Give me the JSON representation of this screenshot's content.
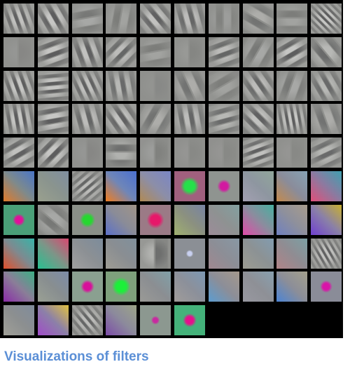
{
  "caption": "Visualizations of filters",
  "grid": {
    "rows": 10,
    "cols": 10,
    "empty_after": 96,
    "filters": [
      {
        "kind": "stripes",
        "angle": -20,
        "freq": 4,
        "contrast": 0.5
      },
      {
        "kind": "stripes",
        "angle": -30,
        "freq": 3,
        "contrast": 0.55
      },
      {
        "kind": "stripes",
        "angle": 80,
        "freq": 2,
        "contrast": 0.25
      },
      {
        "kind": "stripes",
        "angle": 10,
        "freq": 2,
        "contrast": 0.2
      },
      {
        "kind": "stripes",
        "angle": -40,
        "freq": 3,
        "contrast": 0.5
      },
      {
        "kind": "stripes",
        "angle": -15,
        "freq": 3,
        "contrast": 0.45
      },
      {
        "kind": "stripes",
        "angle": 0,
        "freq": 2,
        "contrast": 0.15
      },
      {
        "kind": "stripes",
        "angle": -60,
        "freq": 2,
        "contrast": 0.3
      },
      {
        "kind": "stripes",
        "angle": 90,
        "freq": 2,
        "contrast": 0.2
      },
      {
        "kind": "stripes",
        "angle": -45,
        "freq": 6,
        "contrast": 0.55
      },
      {
        "kind": "stripes",
        "angle": 0,
        "freq": 1,
        "contrast": 0.08
      },
      {
        "kind": "stripes",
        "angle": 70,
        "freq": 3,
        "contrast": 0.55
      },
      {
        "kind": "stripes",
        "angle": -20,
        "freq": 3,
        "contrast": 0.5
      },
      {
        "kind": "stripes",
        "angle": 45,
        "freq": 3,
        "contrast": 0.45
      },
      {
        "kind": "stripes",
        "angle": 80,
        "freq": 2,
        "contrast": 0.2
      },
      {
        "kind": "stripes",
        "angle": 0,
        "freq": 1,
        "contrast": 0.1
      },
      {
        "kind": "stripes",
        "angle": 70,
        "freq": 3,
        "contrast": 0.45
      },
      {
        "kind": "stripes",
        "angle": 30,
        "freq": 2,
        "contrast": 0.25
      },
      {
        "kind": "stripes",
        "angle": 60,
        "freq": 3,
        "contrast": 0.55
      },
      {
        "kind": "stripes",
        "angle": -40,
        "freq": 2,
        "contrast": 0.4
      },
      {
        "kind": "stripes",
        "angle": -20,
        "freq": 4,
        "contrast": 0.55
      },
      {
        "kind": "stripes",
        "angle": 85,
        "freq": 4,
        "contrast": 0.55
      },
      {
        "kind": "stripes",
        "angle": -25,
        "freq": 4,
        "contrast": 0.5
      },
      {
        "kind": "stripes",
        "angle": -10,
        "freq": 3,
        "contrast": 0.4
      },
      {
        "kind": "stripes",
        "angle": 0,
        "freq": 1,
        "contrast": 0.06
      },
      {
        "kind": "stripes",
        "angle": -25,
        "freq": 2,
        "contrast": 0.3
      },
      {
        "kind": "stripes",
        "angle": 60,
        "freq": 2,
        "contrast": 0.2
      },
      {
        "kind": "stripes",
        "angle": -35,
        "freq": 3,
        "contrast": 0.45
      },
      {
        "kind": "stripes",
        "angle": 20,
        "freq": 2,
        "contrast": 0.25
      },
      {
        "kind": "stripes",
        "angle": -30,
        "freq": 3,
        "contrast": 0.4
      },
      {
        "kind": "stripes",
        "angle": -10,
        "freq": 4,
        "contrast": 0.55
      },
      {
        "kind": "stripes",
        "angle": 80,
        "freq": 3,
        "contrast": 0.55
      },
      {
        "kind": "stripes",
        "angle": -15,
        "freq": 3,
        "contrast": 0.45
      },
      {
        "kind": "stripes",
        "angle": -35,
        "freq": 3,
        "contrast": 0.5
      },
      {
        "kind": "stripes",
        "angle": 30,
        "freq": 2,
        "contrast": 0.3
      },
      {
        "kind": "stripes",
        "angle": -10,
        "freq": 3,
        "contrast": 0.45
      },
      {
        "kind": "stripes",
        "angle": 75,
        "freq": 3,
        "contrast": 0.4
      },
      {
        "kind": "stripes",
        "angle": -45,
        "freq": 3,
        "contrast": 0.5
      },
      {
        "kind": "stripes",
        "angle": -10,
        "freq": 5,
        "contrast": 0.55
      },
      {
        "kind": "stripes",
        "angle": -20,
        "freq": 2,
        "contrast": 0.3
      },
      {
        "kind": "stripes",
        "angle": 60,
        "freq": 3,
        "contrast": 0.5
      },
      {
        "kind": "stripes",
        "angle": 45,
        "freq": 3,
        "contrast": 0.55
      },
      {
        "kind": "stripes",
        "angle": 0,
        "freq": 1,
        "contrast": 0.08
      },
      {
        "kind": "stripes",
        "angle": 90,
        "freq": 2,
        "contrast": 0.35
      },
      {
        "kind": "stripes",
        "angle": 0,
        "freq": 1,
        "contrast": 0.15
      },
      {
        "kind": "stripes",
        "angle": 0,
        "freq": 1,
        "contrast": 0.07
      },
      {
        "kind": "stripes",
        "angle": 0,
        "freq": 1,
        "contrast": 0.07
      },
      {
        "kind": "stripes",
        "angle": 70,
        "freq": 4,
        "contrast": 0.5
      },
      {
        "kind": "stripes",
        "angle": 0,
        "freq": 1,
        "contrast": 0.07
      },
      {
        "kind": "stripes",
        "angle": 65,
        "freq": 3,
        "contrast": 0.4
      },
      {
        "kind": "color",
        "bg": "#7e8a8c",
        "a": "#e07a2a",
        "b": "#4a76c8"
      },
      {
        "kind": "color",
        "bg": "#8a948e",
        "a": "#9aa08e",
        "b": "#7f8ea0"
      },
      {
        "kind": "stripes",
        "angle": 50,
        "freq": 5,
        "contrast": 0.45
      },
      {
        "kind": "color",
        "bg": "#6f86b8",
        "a": "#f07d20",
        "b": "#4a70d0"
      },
      {
        "kind": "color",
        "bg": "#8c8ea8",
        "a": "#b08a55",
        "b": "#7a86c6"
      },
      {
        "kind": "blob",
        "bg": "#a0607e",
        "dot": "#26e04a",
        "size": 0.3
      },
      {
        "kind": "blob",
        "bg": "#8f9490",
        "dot": "#d21aa0",
        "size": 0.22
      },
      {
        "kind": "color",
        "bg": "#8e96a0",
        "a": "#a3a0b2",
        "b": "#90a69a"
      },
      {
        "kind": "color",
        "bg": "#8a8c9a",
        "a": "#c38a4e",
        "b": "#86a2b4"
      },
      {
        "kind": "color",
        "bg": "#8c7aa0",
        "a": "#e0507a",
        "b": "#40a0b0"
      },
      {
        "kind": "blob",
        "bg": "#4aa078",
        "dot": "#e0109a",
        "size": 0.2
      },
      {
        "kind": "stripes",
        "angle": -50,
        "freq": 2,
        "contrast": 0.25
      },
      {
        "kind": "blob",
        "bg": "#8a8f88",
        "dot": "#26d830",
        "size": 0.25
      },
      {
        "kind": "color",
        "bg": "#8a8c98",
        "a": "#5c70c8",
        "b": "#a09488"
      },
      {
        "kind": "blob",
        "bg": "#9b7a86",
        "dot": "#e6186a",
        "size": 0.28
      },
      {
        "kind": "color",
        "bg": "#8b9080",
        "a": "#a0b070",
        "b": "#7884a4"
      },
      {
        "kind": "color",
        "bg": "#8e9292",
        "a": "#9c8c98",
        "b": "#82a0a0"
      },
      {
        "kind": "color",
        "bg": "#8c8c9e",
        "a": "#e04aa8",
        "b": "#48b0a0"
      },
      {
        "kind": "color",
        "bg": "#8e909c",
        "a": "#7080c0",
        "b": "#a89c8c"
      },
      {
        "kind": "color",
        "bg": "#8a80a8",
        "a": "#7040d0",
        "b": "#c8b030"
      },
      {
        "kind": "color",
        "bg": "#7e8a90",
        "a": "#e0502c",
        "b": "#38b4a8"
      },
      {
        "kind": "color",
        "bg": "#7c9688",
        "a": "#28c090",
        "b": "#d84870"
      },
      {
        "kind": "color",
        "bg": "#8c9094",
        "a": "#a0a0a0",
        "b": "#7c8c9c"
      },
      {
        "kind": "color",
        "bg": "#8a8e92",
        "a": "#9e9c94",
        "b": "#80909c"
      },
      {
        "kind": "stripes",
        "angle": 0,
        "freq": 1,
        "contrast": 0.35
      },
      {
        "kind": "blob",
        "bg": "#8b8f95",
        "dot": "#c8d0f0",
        "size": 0.12
      },
      {
        "kind": "color",
        "bg": "#8c8e96",
        "a": "#a08890",
        "b": "#8898a4"
      },
      {
        "kind": "color",
        "bg": "#8c9294",
        "a": "#9c9c92",
        "b": "#829cb0"
      },
      {
        "kind": "color",
        "bg": "#908c92",
        "a": "#b08488",
        "b": "#7ca0a4"
      },
      {
        "kind": "stripes",
        "angle": -30,
        "freq": 6,
        "contrast": 0.5
      },
      {
        "kind": "color",
        "bg": "#8a7e98",
        "a": "#8a2ca8",
        "b": "#3cb084"
      },
      {
        "kind": "color",
        "bg": "#888e90",
        "a": "#9aa094",
        "b": "#7c8ca8"
      },
      {
        "kind": "blob",
        "bg": "#8aa090",
        "dot": "#d8109a",
        "size": 0.22
      },
      {
        "kind": "blob",
        "bg": "#7ea07c",
        "dot": "#1cf03a",
        "size": 0.3
      },
      {
        "kind": "color",
        "bg": "#8b8e92",
        "a": "#9a9a96",
        "b": "#80a0a8"
      },
      {
        "kind": "color",
        "bg": "#8c909a",
        "a": "#a09c9a",
        "b": "#7c98b4"
      },
      {
        "kind": "color",
        "bg": "#8c8e98",
        "a": "#5c9cd0",
        "b": "#a4988c"
      },
      {
        "kind": "color",
        "bg": "#8e9096",
        "a": "#9898a0",
        "b": "#88a0b0"
      },
      {
        "kind": "color",
        "bg": "#8c8e98",
        "a": "#4c84d4",
        "b": "#a4a08c"
      },
      {
        "kind": "blob",
        "bg": "#8a8c98",
        "dot": "#d814a8",
        "size": 0.2
      },
      {
        "kind": "color",
        "bg": "#8c8f90",
        "a": "#a0a098",
        "b": "#808c9c"
      },
      {
        "kind": "color",
        "bg": "#8c80a8",
        "a": "#a04cc8",
        "b": "#e0c040"
      },
      {
        "kind": "stripes",
        "angle": -40,
        "freq": 5,
        "contrast": 0.45
      },
      {
        "kind": "color",
        "bg": "#8c8a9c",
        "a": "#7c4ca8",
        "b": "#9ca488"
      },
      {
        "kind": "blob",
        "bg": "#8c9890",
        "dot": "#c82aa0",
        "size": 0.14
      },
      {
        "kind": "blob",
        "bg": "#44b27a",
        "dot": "#e6108c",
        "size": 0.22
      }
    ]
  }
}
